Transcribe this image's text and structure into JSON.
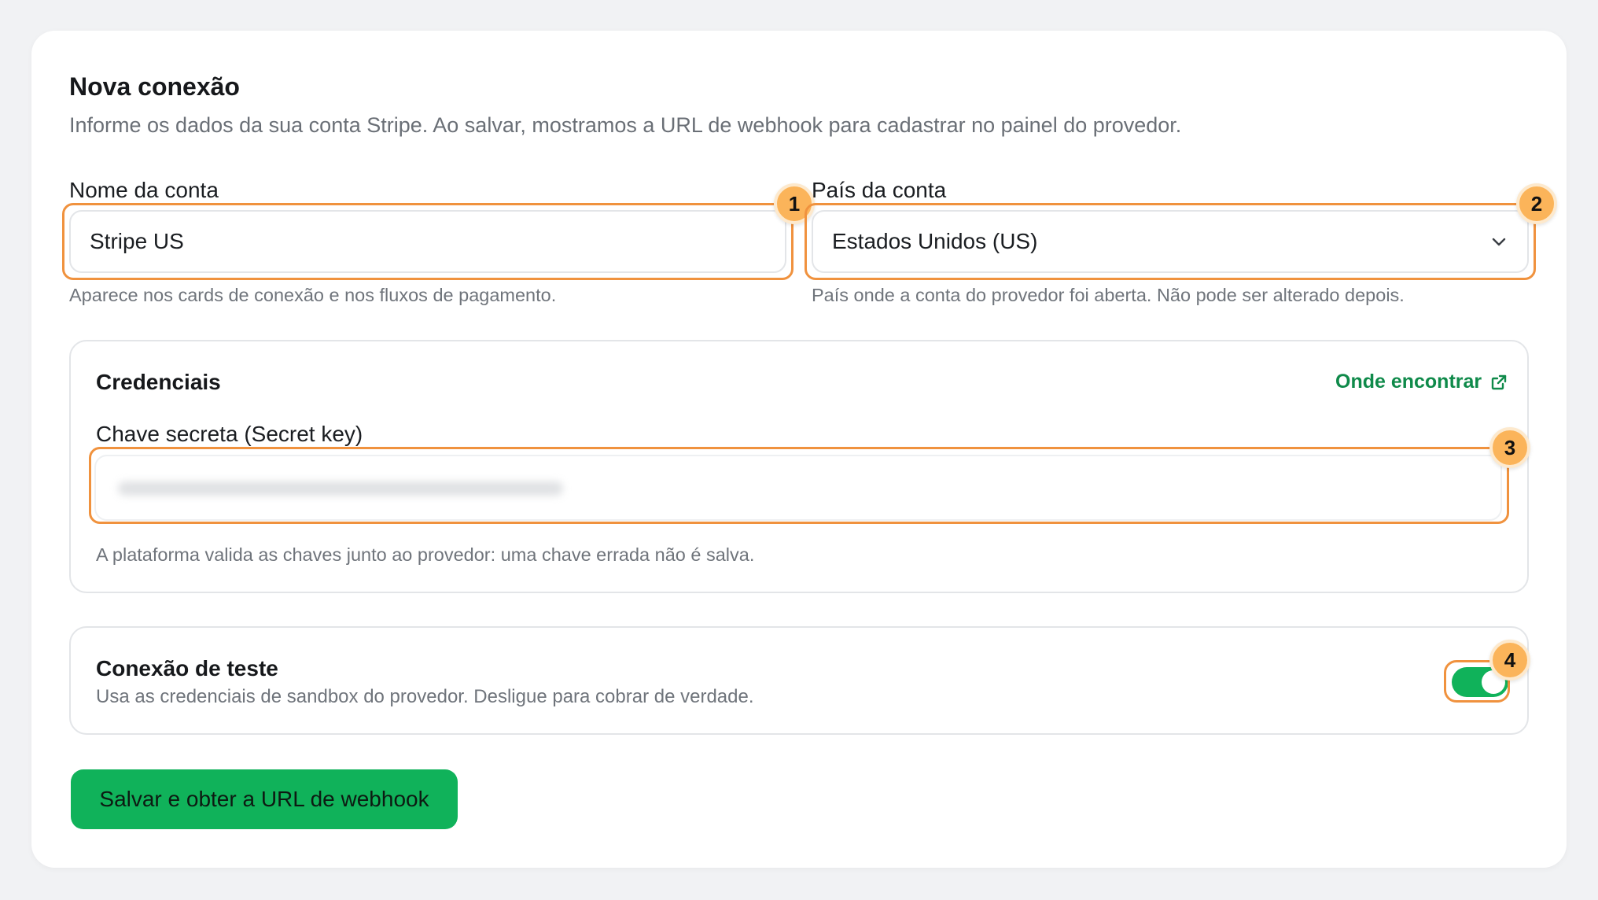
{
  "form": {
    "title": "Nova conexão",
    "subtitle": "Informe os dados da sua conta Stripe. Ao salvar, mostramos a URL de webhook para cadastrar no painel do provedor.",
    "account_name": {
      "label": "Nome da conta",
      "value": "Stripe US",
      "help": "Aparece nos cards de conexão e nos fluxos de pagamento."
    },
    "account_country": {
      "label": "País da conta",
      "value": "Estados Unidos (US)",
      "help": "País onde a conta do provedor foi aberta. Não pode ser alterado depois."
    },
    "credentials": {
      "title": "Credenciais",
      "link_label": "Onde encontrar",
      "secret_key": {
        "label": "Chave secreta (Secret key)",
        "value": "",
        "help": "A plataforma valida as chaves junto ao provedor: uma chave errada não é salva."
      }
    },
    "test_connection": {
      "title": "Conexão de teste",
      "description": "Usa as credenciais de sandbox do provedor. Desligue para cobrar de verdade.",
      "enabled": true
    },
    "submit_label": "Salvar e obter a URL de webhook"
  },
  "annotations": {
    "badge_1": "1",
    "badge_2": "2",
    "badge_3": "3",
    "badge_4": "4"
  },
  "colors": {
    "accent": "#10b25a",
    "link": "#0f8a4a",
    "highlight": "#f0923e",
    "badge": "#fbb45a"
  }
}
